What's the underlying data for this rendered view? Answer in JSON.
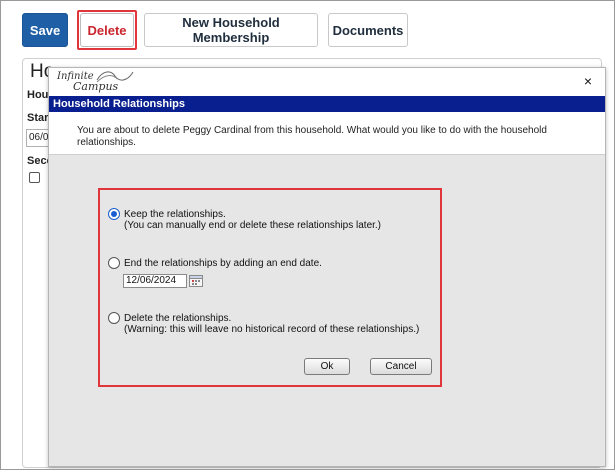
{
  "toolbar": {
    "save_label": "Save",
    "delete_label": "Delete",
    "new_household_membership_label": "New Household Membership",
    "documents_label": "Documents"
  },
  "background_page": {
    "title_partial": "Ho",
    "household_label_partial": "Hous",
    "start_label_partial": "Start",
    "start_value_partial": "06/0",
    "secondary_label_partial": "Seco"
  },
  "modal": {
    "logo_line1": "Infinite",
    "logo_line2": "Campus",
    "close_glyph": "×",
    "header": "Household Relationships",
    "message": "You are about to delete Peggy Cardinal from this household. What would you like to do with the household relationships.",
    "options": [
      {
        "line1": "Keep the relationships.",
        "line2": "(You can manually end or delete these relationships later.)",
        "selected": true
      },
      {
        "line1": "End the relationships by adding an end date.",
        "line2": "",
        "selected": false
      },
      {
        "line1": "Delete the relationships.",
        "line2": "(Warning: this will leave no historical record of these relationships.)",
        "selected": false
      }
    ],
    "end_date_value": "12/06/2024",
    "ok_label": "Ok",
    "cancel_label": "Cancel"
  },
  "colors": {
    "save_button_bg": "#1f5fa6",
    "delete_text": "#c9262d",
    "modal_header_bg": "#0a1f8f",
    "highlight_border": "#e0353a",
    "radio_selected": "#1a5fd0"
  },
  "icons": [
    "close-icon",
    "calendar-icon",
    "infinite-campus-logo"
  ]
}
